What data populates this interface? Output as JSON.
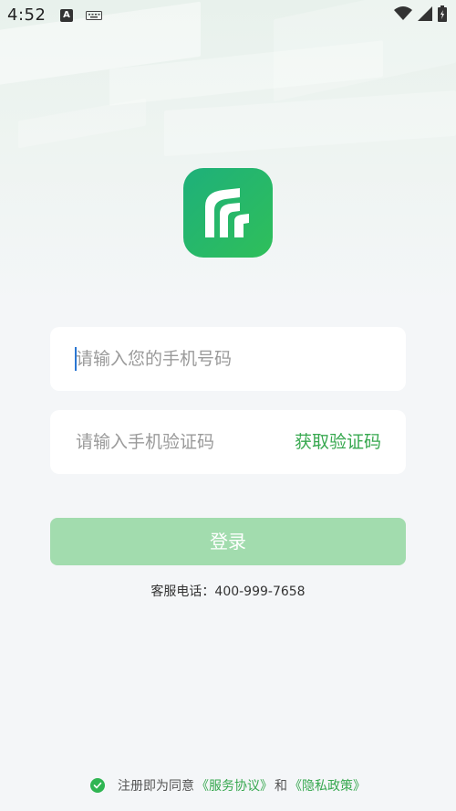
{
  "status_bar": {
    "time": "4:52",
    "a_icon_label": "A",
    "icons": [
      "accessibility-icon",
      "keyboard-icon",
      "wifi-icon",
      "signal-icon",
      "battery-icon"
    ]
  },
  "app": {
    "logo_icon": "app-logo-icon",
    "brand_colors": {
      "logo_start": "#1eb07a",
      "logo_end": "#2fbf5a"
    }
  },
  "form": {
    "phone_placeholder": "请输入您的手机号码",
    "phone_value": "",
    "code_placeholder": "请输入手机验证码",
    "code_value": "",
    "get_code_label": "获取验证码",
    "login_label": "登录"
  },
  "hotline": "客服电话：400-999-7658",
  "agreement": {
    "prefix": "注册即为同意",
    "service_link": "《服务协议》",
    "conjunction": "和",
    "privacy_link": "《隐私政策》",
    "checked": true
  },
  "colors": {
    "accent": "#37a84f",
    "login_button_disabled": "#a2dcae",
    "background": "#f4f6f8"
  }
}
